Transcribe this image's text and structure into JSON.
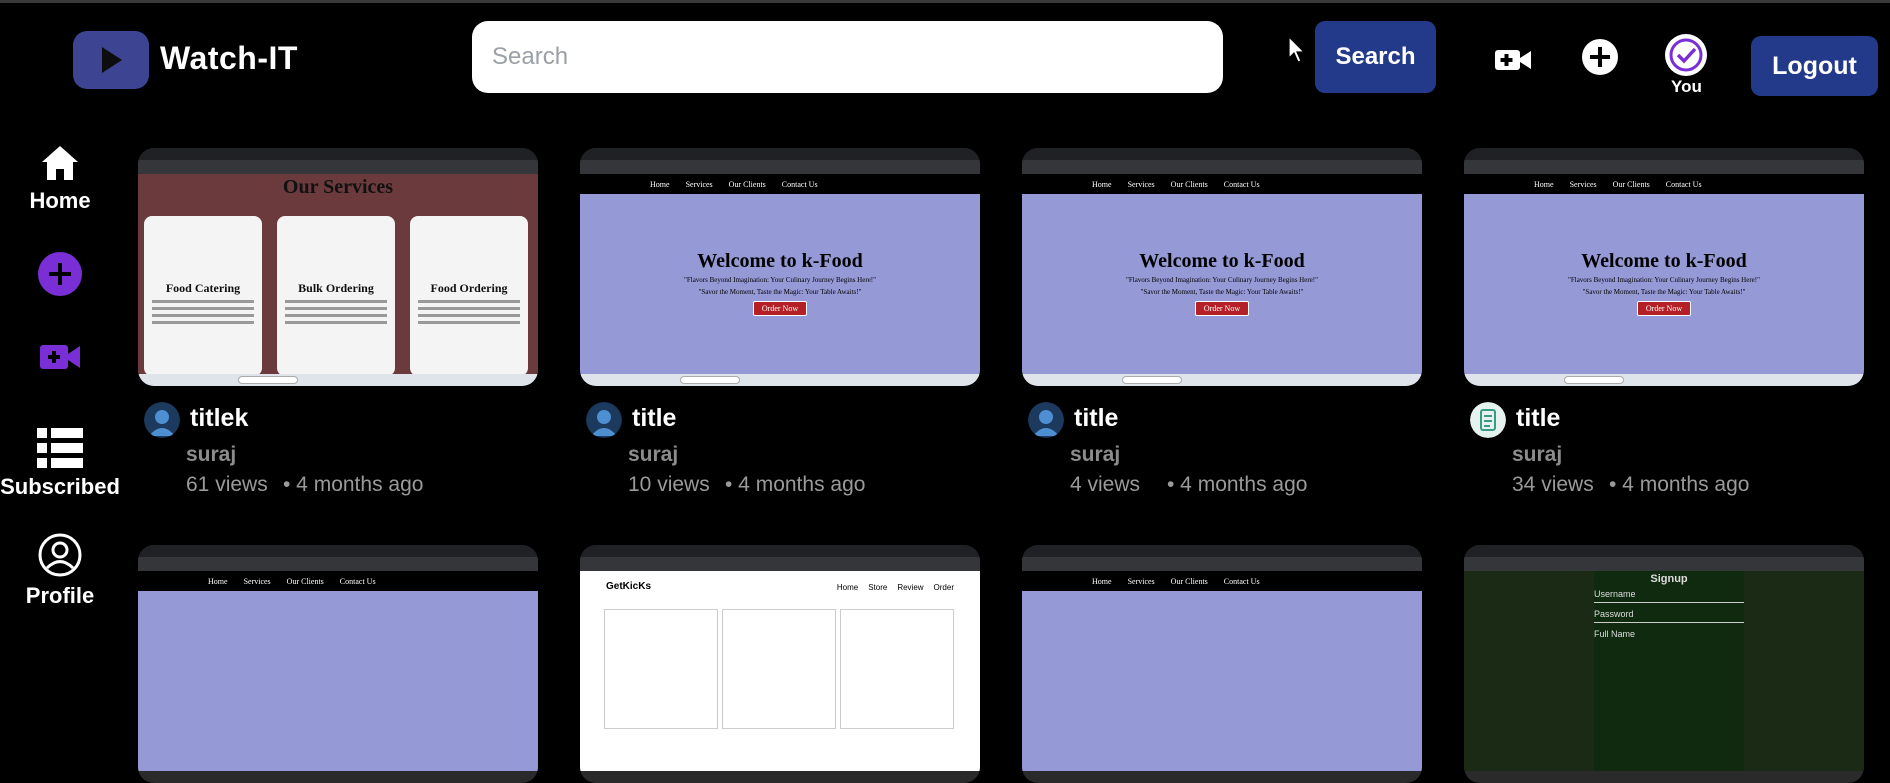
{
  "app": {
    "name": "Watch-IT"
  },
  "search": {
    "placeholder": "Search",
    "button_label": "Search"
  },
  "header": {
    "you_label": "You",
    "logout_label": "Logout"
  },
  "sidebar": {
    "items": [
      {
        "label": "Home",
        "icon": "home-icon"
      },
      {
        "label": "",
        "icon": "add-circle-icon"
      },
      {
        "label": "",
        "icon": "video-camera-icon"
      },
      {
        "label": "Subscribed",
        "icon": "list-icon"
      },
      {
        "label": "Profile",
        "icon": "user-circle-icon"
      }
    ]
  },
  "videos": [
    {
      "title": "titlek",
      "author": "suraj",
      "views": "61 views",
      "age": "• 4 months ago",
      "thumb": "services"
    },
    {
      "title": "title",
      "author": "suraj",
      "views": "10 views",
      "age": "• 4 months ago",
      "thumb": "kfood"
    },
    {
      "title": "title",
      "author": "suraj",
      "views": "4 views",
      "age": "• 4 months ago",
      "thumb": "kfood"
    },
    {
      "title": "title",
      "author": "suraj",
      "views": "34 views",
      "age": "• 4 months ago",
      "thumb": "kfood"
    }
  ],
  "thumbs": {
    "services": {
      "heading": "Our Services",
      "cards": [
        "Food Catering",
        "Bulk Ordering",
        "Food Ordering"
      ]
    },
    "kfood": {
      "nav": [
        "Home",
        "Services",
        "Our Clients",
        "Contact Us"
      ],
      "heading": "Welcome to k-Food",
      "tagline1": "\"Flavors Beyond Imagination: Your Culinary Journey Begins Here!\"",
      "tagline2": "\"Savor the Moment, Taste the Magic: Your Table Awaits!\"",
      "button": "Order Now"
    },
    "kicks": {
      "brand": "GetKicKs",
      "nav": [
        "Home",
        "Store",
        "Review",
        "Order"
      ]
    },
    "signup": {
      "heading": "Signup",
      "fields": [
        "Username",
        "Password",
        "Full Name"
      ]
    }
  },
  "colors": {
    "accent": "#233a8a",
    "logo_bg": "#3d4593",
    "sidebar_icon_purple": "#7a2fd6"
  }
}
